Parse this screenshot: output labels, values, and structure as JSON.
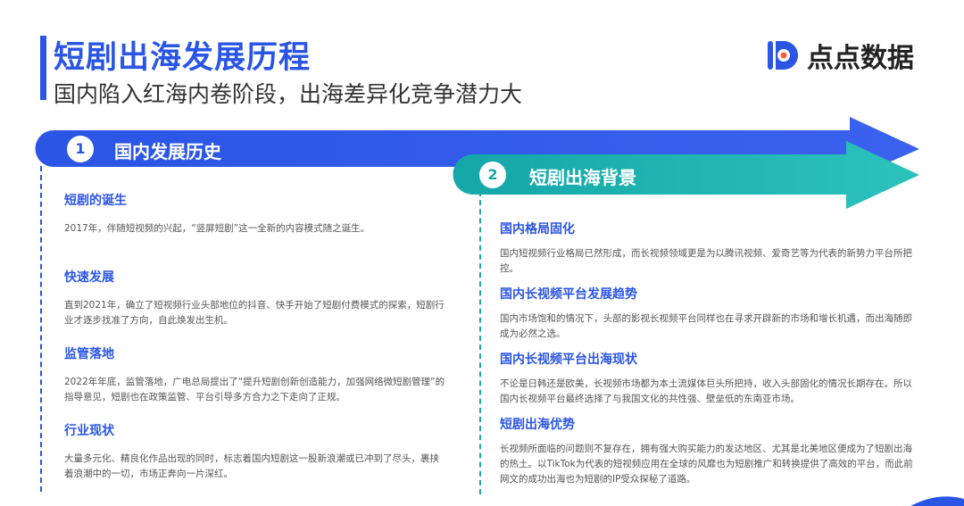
{
  "header": {
    "title": "短剧出海发展历程",
    "subtitle": "国内陷入红海内卷阶段，出海差异化竞争潜力大"
  },
  "logo": {
    "text": "点点数据",
    "icon": "dian-dian-logo-icon",
    "color": "#2a55e5"
  },
  "section1": {
    "number": "1",
    "title": "国内发展历史",
    "color": "#2a55e5",
    "items": [
      {
        "heading": "短剧的诞生",
        "body": "2017年，伴随短视频的兴起，“竖屏短剧”这一全新的内容模式随之诞生。"
      },
      {
        "heading": "快速发展",
        "body": "直到2021年，确立了短视频行业头部地位的抖音、快手开始了短剧付费模式的探索，短剧行业才逐步找准了方向，自此焕发出生机。"
      },
      {
        "heading": "监管落地",
        "body": "2022年年底，监管落地，广电总局提出了“提升短剧创新创造能力，加强网络微短剧管理”的指导意见，短剧也在政策监管、平台引导多方合力之下走向了正规。"
      },
      {
        "heading": "行业现状",
        "body": "大量多元化、精良化作品出现的同时，标志着国内短剧这一股新浪潮或已冲到了尽头，裹挟着浪潮中的一切，市场正奔向一片深红。"
      }
    ]
  },
  "section2": {
    "number": "2",
    "title": "短剧出海背景",
    "color": "#1aa6ac",
    "items": [
      {
        "heading": "国内格局固化",
        "body": "国内短视频行业格局已然形成，而长视频领域更是为以腾讯视频、爱奇艺等为代表的新势力平台所把控。"
      },
      {
        "heading": "国内长视频平台发展趋势",
        "body": "国内市场饱和的情况下，头部的影视长视频平台同样也在寻求开辟新的市场和增长机遇，而出海随即成为必然之选。"
      },
      {
        "heading": "国内长视频平台出海现状",
        "body": "不论是日韩还是欧美，长视频市场都为本土流媒体巨头所把持，收入头部固化的情况长期存在。所以国内长视频平台最终选择了与我国文化的共性强、壁垒低的东南亚市场。"
      },
      {
        "heading": "短剧出海优势",
        "body": "长视频所面临的问题则不复存在，拥有强大购买能力的发达地区、尤其是北美地区便成为了短剧出海的热土。以TikTok为代表的短视频应用在全球的风靡也为短剧推广和转换提供了高效的平台，而此前网文的成功出海也为短剧的IP受众探秘了道路。"
      }
    ]
  }
}
